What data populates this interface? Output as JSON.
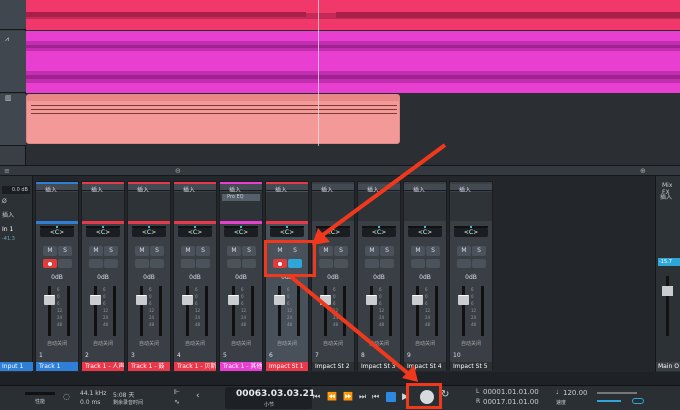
{
  "arrange": {
    "track_icons": [
      "waveform-icon",
      "piano-icon"
    ],
    "colors": {
      "audio1": "#f0386a",
      "audio2": "#e83fd0",
      "instrument": "#f39a98"
    }
  },
  "left_panel": {
    "gain": "0.0 dB",
    "phase": "Ø",
    "insert": "插入",
    "input": "In 1",
    "input_level": "-41.3",
    "bottom_label": "Input 1"
  },
  "strips": [
    {
      "insert": "插入",
      "plugin": "",
      "pan": "<C>",
      "vol": "0dB",
      "auto": "自动关闭",
      "num": "1",
      "label": "Track 1",
      "color": "#2f7fd8",
      "rec": true,
      "mon": false
    },
    {
      "insert": "插入",
      "plugin": "",
      "pan": "<C>",
      "vol": "0dB",
      "auto": "自动关闭",
      "num": "2",
      "label": "Track 1 - 人声",
      "color": "#e8384a",
      "rec": false,
      "mon": false
    },
    {
      "insert": "插入",
      "plugin": "",
      "pan": "<C>",
      "vol": "0dB",
      "auto": "自动关闭",
      "num": "3",
      "label": "Track 1 - 鼓",
      "color": "#e8384a",
      "rec": false,
      "mon": false
    },
    {
      "insert": "插入",
      "plugin": "",
      "pan": "<C>",
      "vol": "0dB",
      "auto": "自动关闭",
      "num": "4",
      "label": "Track 1 - 贝斯",
      "color": "#e8384a",
      "rec": false,
      "mon": false
    },
    {
      "insert": "插入",
      "plugin": "Pro EQ",
      "pan": "<C>",
      "vol": "0dB",
      "auto": "自动关闭",
      "num": "5",
      "label": "Track 1 - 其他",
      "color": "#e83fd0",
      "rec": false,
      "mon": false
    },
    {
      "insert": "插入",
      "plugin": "",
      "pan": "<C>",
      "vol": "0dB",
      "auto": "自动关闭",
      "num": "6",
      "label": "Impact St 1",
      "color": "#e8384a",
      "rec": true,
      "mon": true
    },
    {
      "insert": "插入",
      "plugin": "",
      "pan": "<C>",
      "vol": "0dB",
      "auto": "自动关闭",
      "num": "7",
      "label": "Impact St 2",
      "color": "#3a3f45",
      "rec": false,
      "mon": false
    },
    {
      "insert": "插入",
      "plugin": "",
      "pan": "<C>",
      "vol": "0dB",
      "auto": "自动关闭",
      "num": "8",
      "label": "Impact St 3",
      "color": "#3a3f45",
      "rec": false,
      "mon": false
    },
    {
      "insert": "插入",
      "plugin": "",
      "pan": "<C>",
      "vol": "0dB",
      "auto": "自动关闭",
      "num": "9",
      "label": "Impact St 4",
      "color": "#3a3f45",
      "rec": false,
      "mon": false
    },
    {
      "insert": "插入",
      "plugin": "",
      "pan": "<C>",
      "vol": "0dB",
      "auto": "自动关闭",
      "num": "10",
      "label": "Impact St 5",
      "color": "#3a3f45",
      "rec": false,
      "mon": false
    }
  ],
  "mixfx": {
    "title": "Mix FX",
    "insert": "插入",
    "level": "-15.7",
    "bottom_label": "Main O"
  },
  "transport": {
    "perf_label": "性能",
    "sample_rate": "44.1 kHz",
    "latency": "0.0 ms",
    "rec_time": "5:08 天",
    "rec_time_label": "剩余录音时间",
    "position": "00063.03.03.21",
    "position_unit": "小节",
    "loop_start": "00001.01.01.00",
    "loop_end": "00017.01.01.00",
    "loop_l": "L",
    "loop_r": "R",
    "tempo": "120.00",
    "tempo_label": "速度"
  }
}
